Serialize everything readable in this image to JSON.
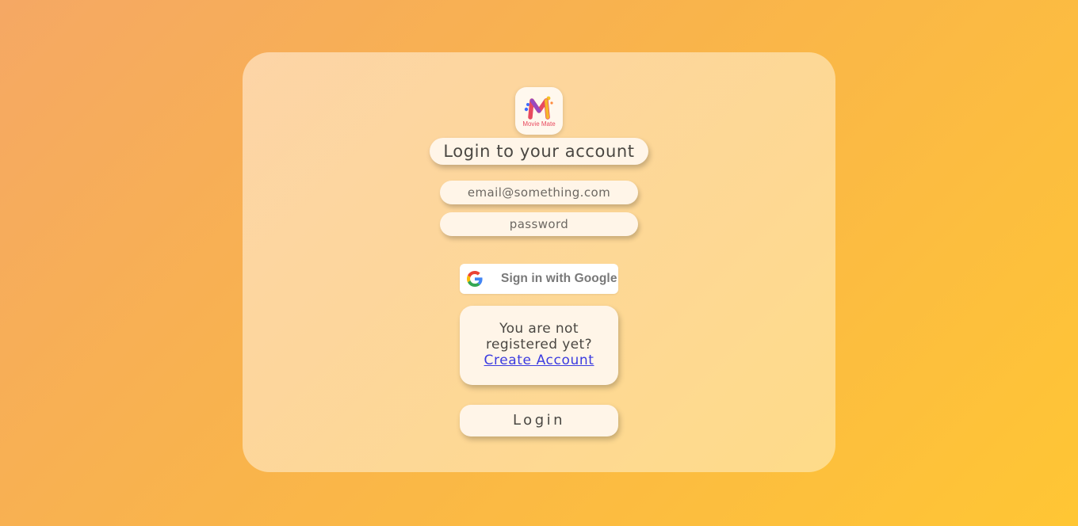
{
  "app": {
    "logo_text": "Movie Mate",
    "logo_icon": "movie-mate-logo",
    "brand_colors": [
      "#e84a5f",
      "#3d6bff",
      "#f7c325",
      "#ff8a3d"
    ]
  },
  "login": {
    "title": "Login to your account",
    "email_placeholder": "email@something.com",
    "password_placeholder": "password",
    "google_button_label": "Sign in with Google",
    "google_icon": "google-g-icon",
    "register_prompt_line1": "You are not",
    "register_prompt_line2": "registered yet?",
    "create_account_link": "Create Account",
    "submit_label": "Login"
  },
  "colors": {
    "background_start": "#f5a864",
    "background_end": "#ffc634",
    "card": "#ffe4c4",
    "pill": "#fff5e8",
    "link": "#3b3be0",
    "text": "#4a4742"
  }
}
